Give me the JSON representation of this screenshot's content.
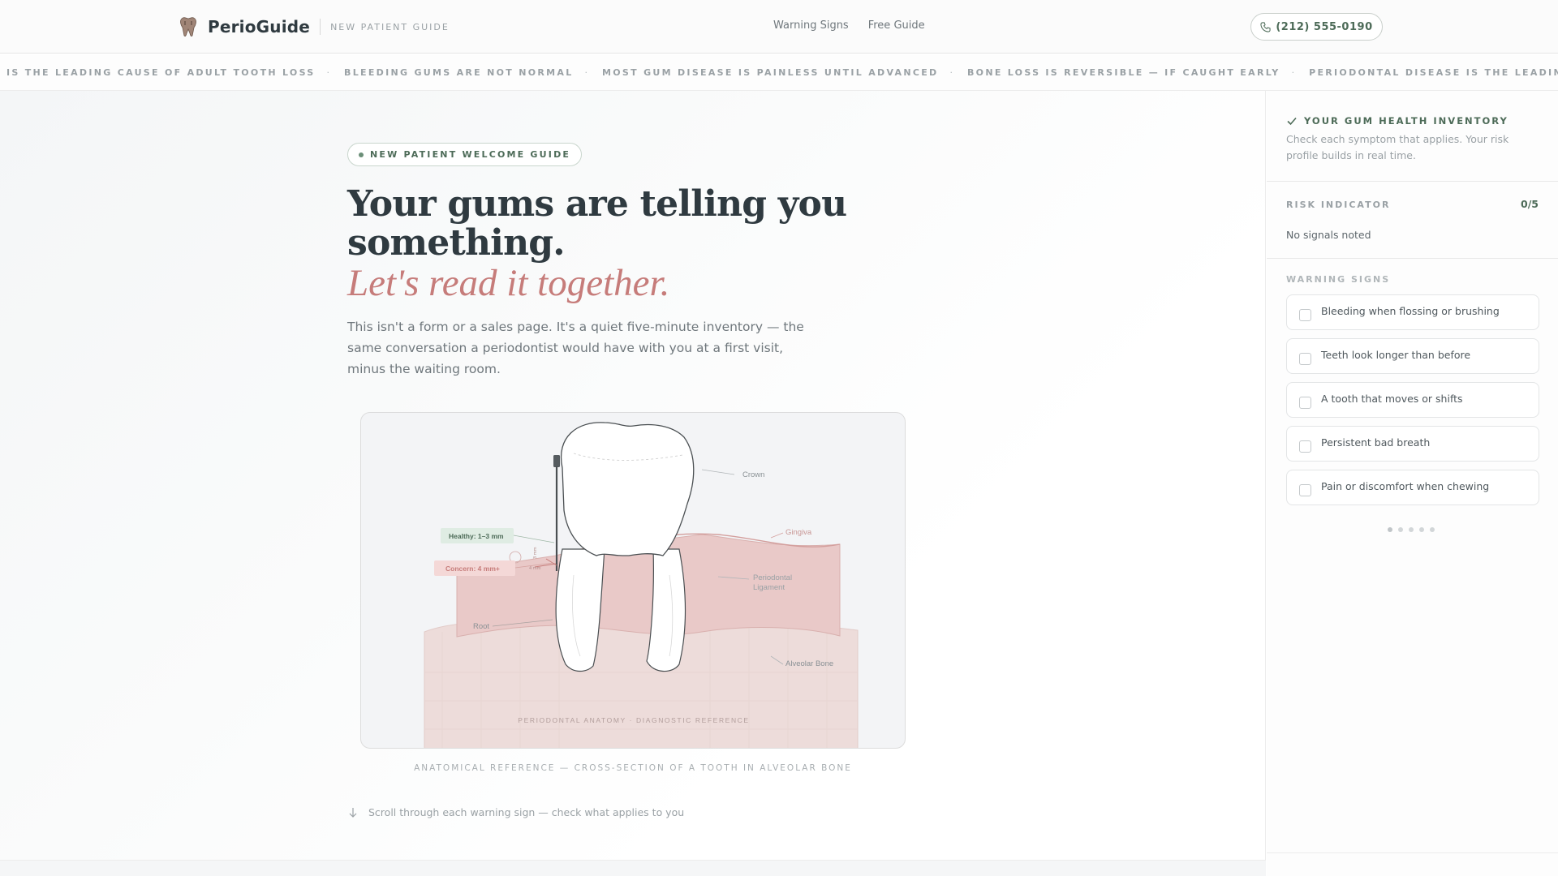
{
  "header": {
    "brand_name": "PerioGuide",
    "brand_tag": "NEW PATIENT GUIDE",
    "nav": [
      {
        "label": "Warning Signs"
      },
      {
        "label": "Free Guide"
      }
    ],
    "phone": "(212) 555-0190"
  },
  "ticker": {
    "items": [
      "IS THE LEADING CAUSE OF ADULT TOOTH LOSS",
      "BLEEDING GUMS ARE NOT NORMAL",
      "MOST GUM DISEASE IS PAINLESS UNTIL ADVANCED",
      "BONE LOSS IS REVERSIBLE — IF CAUGHT EARLY",
      "PERIODONTAL DISEASE IS THE LEADING CAUS"
    ],
    "separator": "·"
  },
  "hero": {
    "pill": "NEW PATIENT WELCOME GUIDE",
    "title": "Your gums are telling you something.",
    "subtitle": "Let's read it together.",
    "body": "This isn't a form or a sales page. It's a quiet five-minute inventory — the same conversation a periodontist would have with you at a first visit, minus the waiting room."
  },
  "figure": {
    "labels": {
      "crown": "Crown",
      "gingiva": "Gingiva",
      "ligament_1": "Periodontal",
      "ligament_2": "Ligament",
      "bone": "Alveolar Bone",
      "root": "Root",
      "healthy": "Healthy: 1–3 mm",
      "concern": "Concern: 4 mm+",
      "footer": "PERIODONTAL ANATOMY · DIAGNOSTIC REFERENCE"
    },
    "caption": "ANATOMICAL REFERENCE — CROSS-SECTION OF A TOOTH IN ALVEOLAR BONE",
    "colors": {
      "gum": "#e9c9c8",
      "bone": "#eddcda",
      "healthy": "#dfece3",
      "concern": "#f4d8d7"
    }
  },
  "scroll_hint": "Scroll through each warning sign — check what applies to you",
  "panel": {
    "title": "YOUR GUM HEALTH INVENTORY",
    "description": "Check each symptom that applies. Your risk profile builds in real time.",
    "risk_label": "RISK INDICATOR",
    "risk_score": "0/5",
    "risk_status": "No signals noted",
    "signs_label": "WARNING SIGNS",
    "signs": [
      {
        "label": "Bleeding when flossing or brushing",
        "checked": false
      },
      {
        "label": "Teeth look longer than before",
        "checked": false
      },
      {
        "label": "A tooth that moves or shifts",
        "checked": false
      },
      {
        "label": "Persistent bad breath",
        "checked": false
      },
      {
        "label": "Pain or discomfort when chewing",
        "checked": false
      }
    ],
    "pager": {
      "pages": 5,
      "current": 1
    }
  },
  "colors": {
    "accent": "#4d6b58",
    "rose": "#c67c7a",
    "text": "#2f3a40"
  }
}
